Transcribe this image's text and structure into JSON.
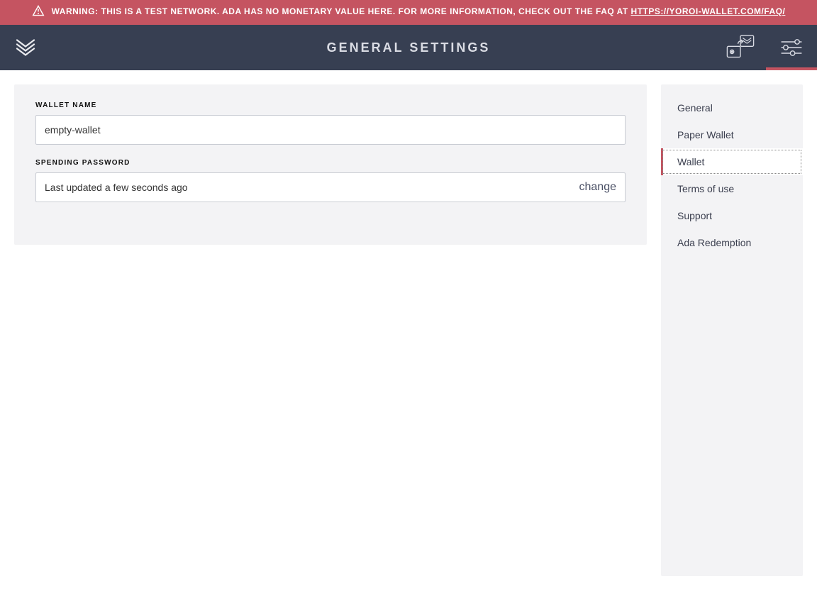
{
  "warning": {
    "prefix": "WARNING:",
    "text": " THIS IS A TEST NETWORK. ADA HAS NO MONETARY VALUE HERE. FOR MORE INFORMATION, CHECK OUT THE FAQ AT ",
    "link": "HTTPS://YOROI-WALLET.COM/FAQ/"
  },
  "header": {
    "title": "GENERAL SETTINGS"
  },
  "form": {
    "walletName": {
      "label": "WALLET NAME",
      "value": "empty-wallet"
    },
    "spendingPassword": {
      "label": "SPENDING PASSWORD",
      "status": "Last updated a few seconds ago",
      "action": "change"
    }
  },
  "sidebar": {
    "items": [
      {
        "label": "General"
      },
      {
        "label": "Paper Wallet"
      },
      {
        "label": "Wallet"
      },
      {
        "label": "Terms of use"
      },
      {
        "label": "Support"
      },
      {
        "label": "Ada Redemption"
      }
    ],
    "activeIndex": 2
  }
}
